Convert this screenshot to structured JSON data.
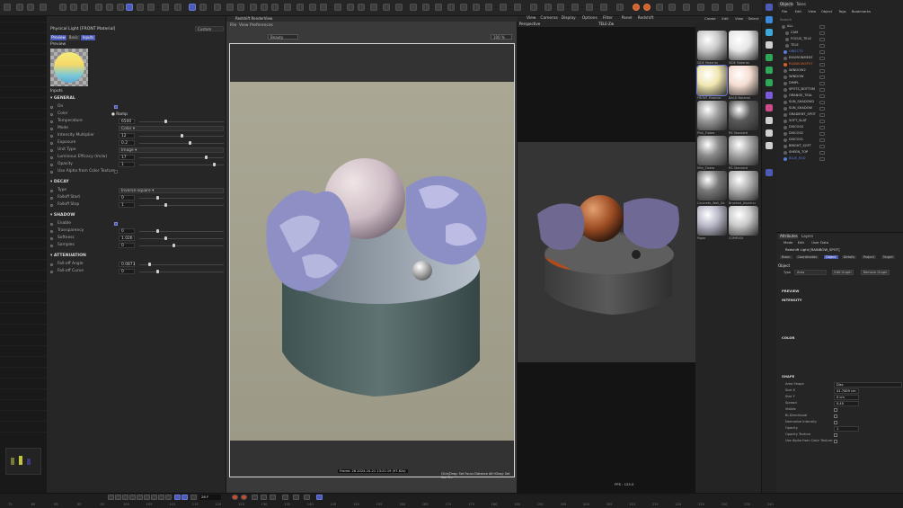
{
  "app": {
    "title": "Cinema 4D"
  },
  "attributes": {
    "title": "Physical Light [FRONT Material]",
    "mode": "Custom",
    "tabs": [
      "Preview",
      "Basic",
      "Inputs"
    ],
    "preview_label": "Preview",
    "inputs_label": "Inputs",
    "sections": {
      "general": "GENERAL",
      "decay": "DECAY",
      "shadow": "SHADOW",
      "attenuation": "ATTENUATION"
    },
    "general": [
      {
        "label": "On"
      },
      {
        "label": "Color",
        "value": "Ramp"
      },
      {
        "label": "Temperature",
        "value": "6500"
      },
      {
        "label": "Mode",
        "value": "Color"
      },
      {
        "label": "Intensity Multiplier",
        "value": "12"
      },
      {
        "label": "Exposure",
        "value": "0.2"
      },
      {
        "label": "Unit Type",
        "value": "Image"
      },
      {
        "label": "Luminous Efficacy (lm/w)",
        "value": "17"
      },
      {
        "label": "Opacity",
        "value": "1"
      },
      {
        "label": "Use Alpha from Color Texture"
      }
    ],
    "decay": [
      {
        "label": "Type",
        "value": "Inverse-square"
      },
      {
        "label": "Falloff Start",
        "value": "0"
      },
      {
        "label": "Falloff Stop",
        "value": "1"
      }
    ],
    "shadow": [
      {
        "label": "Enable"
      },
      {
        "label": "Transparency",
        "value": "0"
      },
      {
        "label": "Softness",
        "value": "1.026"
      },
      {
        "label": "Samples",
        "value": "0"
      }
    ],
    "attenuation": [
      {
        "label": "Fall-off Angle",
        "value": "0.0873"
      },
      {
        "label": "Fall-off Curve",
        "value": "0"
      }
    ]
  },
  "renderview": {
    "title": "Redshift RenderView",
    "menu": [
      "File",
      "View",
      "Preferences"
    ],
    "zoom": "Beauty",
    "frame_info": "Frame: 28   2024-10-21  13:21:19  (97.62s)",
    "hint": "Click/Drag: Set Focus Distance  Alt+Drag: Set Col. R...",
    "progress": "100 %"
  },
  "viewport": {
    "menu": [
      "View",
      "Cameras",
      "Display",
      "Options",
      "Filter",
      "Panel",
      "Redshift"
    ],
    "camera": "Perspective",
    "name": "TELE-Zw",
    "fps": "FPS : 125.0"
  },
  "materials": {
    "menu": [
      "Create",
      "Edit",
      "View",
      "Select"
    ],
    "items": [
      {
        "name": "SIDE Material",
        "color": "#c8c8c8"
      },
      {
        "name": "SIDE Material",
        "color": "#e6e6e6"
      },
      {
        "name": "FRONT Material",
        "color": "#f0e6b0"
      },
      {
        "name": "BACK Material",
        "color": "#f5dcd0"
      },
      {
        "name": "Pink_Flakes",
        "color": "#9a9a9a"
      },
      {
        "name": "RS Standard",
        "color": "#5a5a5a"
      },
      {
        "name": "Mini_Flakes",
        "color": "#8a8a8a"
      },
      {
        "name": "RS Standard",
        "color": "#a5a5a5"
      },
      {
        "name": "Concrete_Wall_Ga",
        "color": "#787878"
      },
      {
        "name": "Brushed_Aluminu",
        "color": "#b0b0b0"
      },
      {
        "name": "Paper",
        "color": "#b8b8c8"
      },
      {
        "name": "COMPLEX",
        "color": "#c9c9c9"
      }
    ]
  },
  "objects": {
    "tabs": [
      "Objects",
      "Takes"
    ],
    "menu": [
      "File",
      "Edit",
      "View",
      "Object",
      "Tags",
      "Bookmarks"
    ],
    "search": "Search",
    "items": [
      {
        "name": "ALL",
        "color": "#888888"
      },
      {
        "name": "CAM",
        "color": "#888888"
      },
      {
        "name": "FOCUS_TELE",
        "color": "#888888"
      },
      {
        "name": "TELE",
        "color": "#888888"
      },
      {
        "name": "OBJECTS",
        "color": "#5a7ad8"
      },
      {
        "name": "ENVIRONMENT",
        "color": "#888888"
      },
      {
        "name": "RAINBOWSPOT",
        "color": "#d2622b"
      },
      {
        "name": "WINDOW2",
        "color": "#888888"
      },
      {
        "name": "WINDOW",
        "color": "#888888"
      },
      {
        "name": "DIMPL",
        "color": "#888888"
      },
      {
        "name": "SPOTS_BOTTOM",
        "color": "#888888"
      },
      {
        "name": "ORANGE_TEAL",
        "color": "#888888"
      },
      {
        "name": "SUN_SHADOW2",
        "color": "#888888"
      },
      {
        "name": "SUN_SHADOW",
        "color": "#888888"
      },
      {
        "name": "GRADIENT_SPOT",
        "color": "#888888"
      },
      {
        "name": "SOFT_SLAT",
        "color": "#888888"
      },
      {
        "name": "DISCO03",
        "color": "#888888"
      },
      {
        "name": "DISCO02",
        "color": "#888888"
      },
      {
        "name": "DISCO01",
        "color": "#888888"
      },
      {
        "name": "BRIGHT_SOFT",
        "color": "#888888"
      },
      {
        "name": "SHEEN_TOP",
        "color": "#888888"
      },
      {
        "name": "BLUE_RED",
        "color": "#5a7ad8"
      }
    ]
  },
  "attr2": {
    "tabs": [
      "Attributes",
      "Layers"
    ],
    "menu": [
      "Mode",
      "Edit",
      "User Data"
    ],
    "title": "Redshift Light [RAINBOW_SPOT]",
    "subtabs": [
      "Basic",
      "Coordinates",
      "Object",
      "Details",
      "Project",
      "Target"
    ],
    "object_label": "Object",
    "type_label": "Type",
    "type_value": "Area",
    "edit_graph": "Edit Graph",
    "remove_graph": "Remove Graph",
    "sections": [
      "PREVIEW",
      "INTENSITY",
      "COLOR",
      "SHAPE"
    ],
    "shape": [
      {
        "label": "Area Shape",
        "value": "Disc"
      },
      {
        "label": "Size X",
        "value": "41.7409 cm"
      },
      {
        "label": "Size Y",
        "value": "0 cm"
      },
      {
        "label": "Spread",
        "value": "0.45"
      },
      {
        "label": "Visible",
        "value": ""
      },
      {
        "label": "Bi-Directional",
        "value": ""
      },
      {
        "label": "Normalize Intensity",
        "value": ""
      },
      {
        "label": "Opacity",
        "value": "1"
      },
      {
        "label": "Opacity Texture",
        "value": ""
      },
      {
        "label": "Use Alpha from Color Texture",
        "value": ""
      }
    ]
  },
  "timeline": {
    "ticks": [
      "75",
      "80",
      "85",
      "90",
      "95",
      "100",
      "105",
      "110",
      "115",
      "120",
      "125",
      "130",
      "135",
      "140",
      "145",
      "150",
      "155",
      "160",
      "165",
      "170",
      "175",
      "180",
      "185",
      "190",
      "195",
      "200",
      "205",
      "210",
      "215",
      "220",
      "225",
      "230",
      "235",
      "240"
    ],
    "frame": "28 F"
  }
}
